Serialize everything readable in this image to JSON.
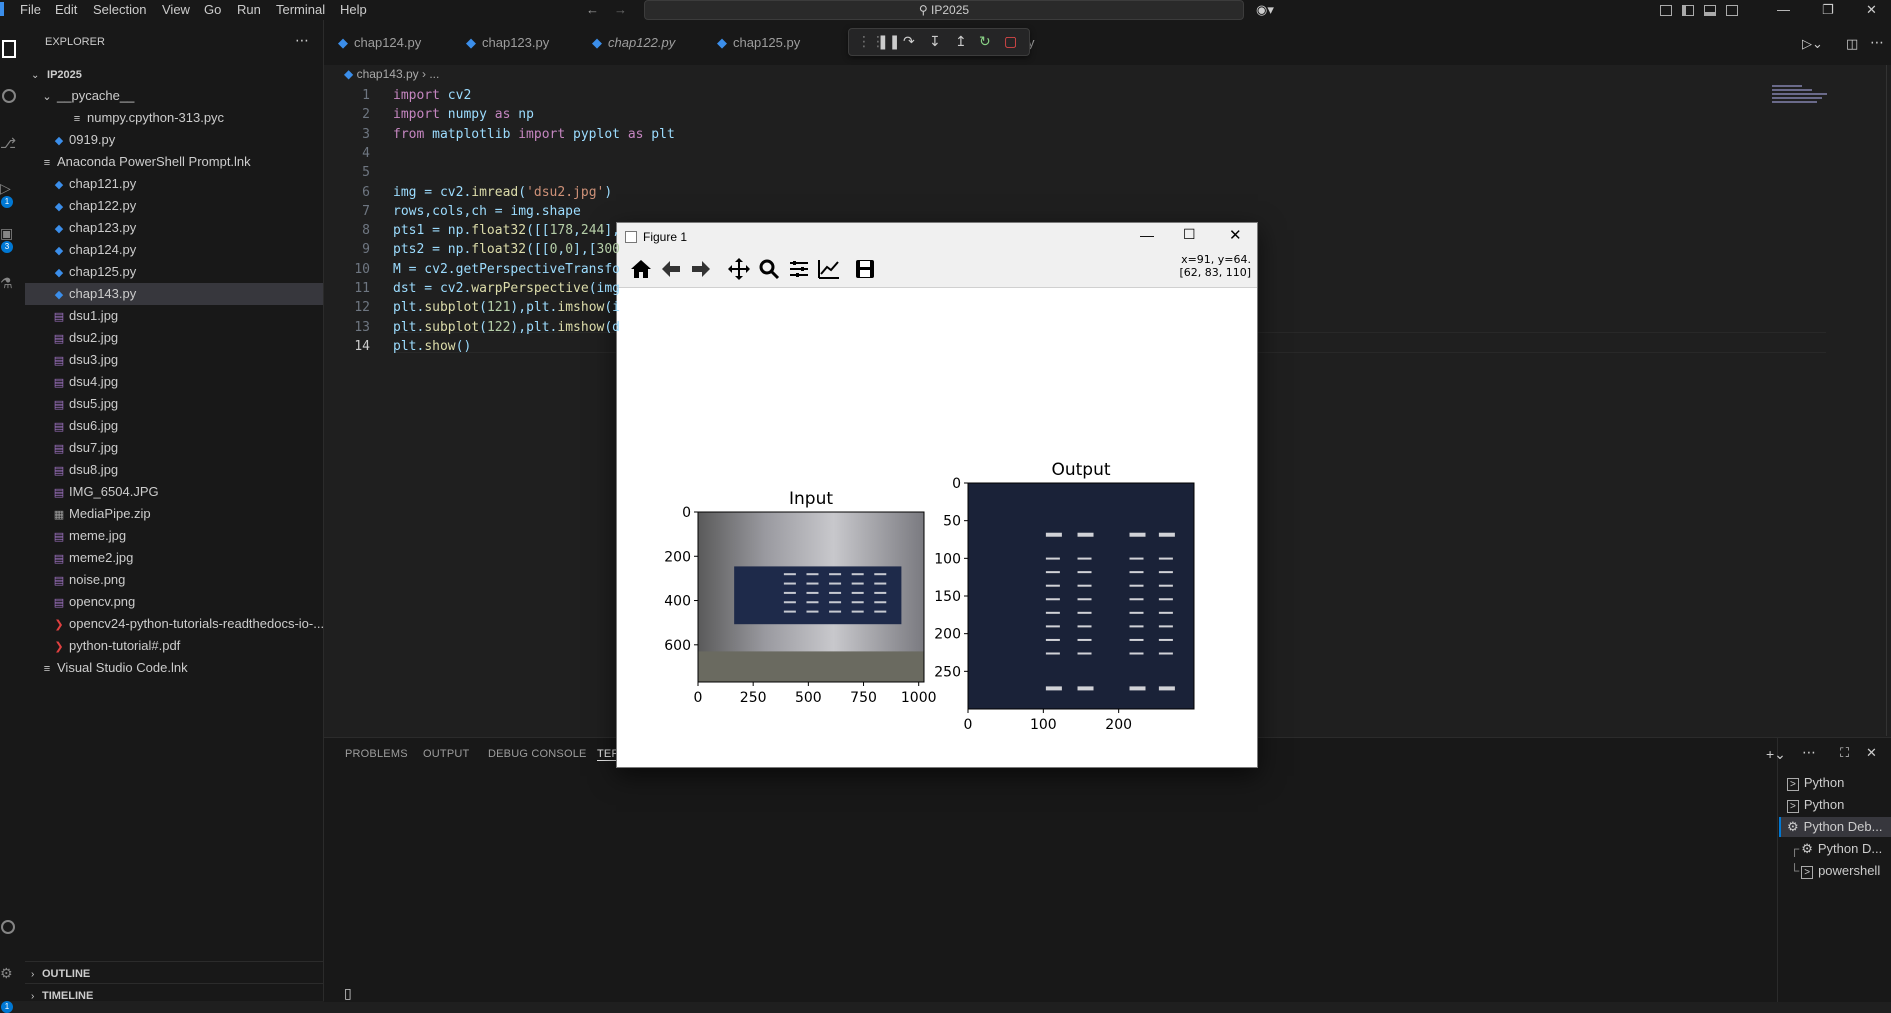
{
  "menu": {
    "file": "File",
    "edit": "Edit",
    "selection": "Selection",
    "view": "View",
    "go": "Go",
    "run": "Run",
    "terminal": "Terminal",
    "help": "Help"
  },
  "search": {
    "text": "IP2025"
  },
  "explorer": {
    "title": "EXPLORER",
    "root": "IP2025",
    "items": [
      {
        "label": "__pycache__",
        "type": "folder"
      },
      {
        "label": "numpy.cpython-313.pyc",
        "type": "file"
      },
      {
        "label": "0919.py",
        "type": "py"
      },
      {
        "label": "Anaconda PowerShell Prompt.lnk",
        "type": "file"
      },
      {
        "label": "chap121.py",
        "type": "py"
      },
      {
        "label": "chap122.py",
        "type": "py"
      },
      {
        "label": "chap123.py",
        "type": "py"
      },
      {
        "label": "chap124.py",
        "type": "py"
      },
      {
        "label": "chap125.py",
        "type": "py"
      },
      {
        "label": "chap143.py",
        "type": "py"
      },
      {
        "label": "dsu1.jpg",
        "type": "img"
      },
      {
        "label": "dsu2.jpg",
        "type": "img"
      },
      {
        "label": "dsu3.jpg",
        "type": "img"
      },
      {
        "label": "dsu4.jpg",
        "type": "img"
      },
      {
        "label": "dsu5.jpg",
        "type": "img"
      },
      {
        "label": "dsu6.jpg",
        "type": "img"
      },
      {
        "label": "dsu7.jpg",
        "type": "img"
      },
      {
        "label": "dsu8.jpg",
        "type": "img"
      },
      {
        "label": "IMG_6504.JPG",
        "type": "img"
      },
      {
        "label": "MediaPipe.zip",
        "type": "zip"
      },
      {
        "label": "meme.jpg",
        "type": "img"
      },
      {
        "label": "meme2.jpg",
        "type": "img"
      },
      {
        "label": "noise.png",
        "type": "img"
      },
      {
        "label": "opencv.png",
        "type": "img"
      },
      {
        "label": "opencv24-python-tutorials-readthedocs-io-...",
        "type": "pdf"
      },
      {
        "label": "python-tutorial#.pdf",
        "type": "pdf"
      },
      {
        "label": "Visual Studio Code.lnk",
        "type": "file"
      }
    ],
    "outline": "OUTLINE",
    "timeline": "TIMELINE"
  },
  "tabs": [
    "chap124.py",
    "chap123.py",
    "chap122.py",
    "chap125.py",
    "y"
  ],
  "breadcrumb": {
    "file": "chap143.py",
    "rest": "..."
  },
  "code": {
    "line_numbers": [
      "1",
      "2",
      "3",
      "4",
      "5",
      "6",
      "7",
      "8",
      "9",
      "10",
      "11",
      "12",
      "13",
      "14"
    ],
    "l1": "import cv2",
    "l2": "import numpy as np",
    "l3": "from matplotlib import pyplot as plt",
    "l6": "img = cv2.imread('dsu2.jpg')",
    "l7": "rows,cols,ch = img.shape",
    "l8": "pts1 = np.float32([[178,244],",
    "l9": "pts2 = np.float32([[0,0],[300",
    "l10": "M = cv2.getPerspectiveTransfo",
    "l11": "dst = cv2.warpPerspective(img",
    "l12": "plt.subplot(121),plt.imshow(i",
    "l13": "plt.subplot(122),plt.imshow(d",
    "l14": "plt.show()"
  },
  "panel": {
    "problems": "PROBLEMS",
    "output": "OUTPUT",
    "debug_console": "DEBUG CONSOLE",
    "terminal": "TER"
  },
  "terminals": [
    "Python",
    "Python",
    "Python Deb...",
    "Python D...",
    "powershell"
  ],
  "figure": {
    "title": "Figure 1",
    "coords_line1": "x=91, y=64.",
    "coords_line2": "[62, 83, 110]"
  },
  "chart_data": [
    {
      "type": "image",
      "title": "Input",
      "x_ticks": [
        "0",
        "250",
        "500",
        "750",
        "1000"
      ],
      "y_ticks": [
        "0",
        "200",
        "400",
        "600"
      ],
      "xlim": [
        0,
        1024
      ],
      "ylim": [
        768,
        0
      ]
    },
    {
      "type": "image",
      "title": "Output",
      "x_ticks": [
        "0",
        "100",
        "200"
      ],
      "y_ticks": [
        "0",
        "50",
        "100",
        "150",
        "200",
        "250"
      ],
      "xlim": [
        0,
        300
      ],
      "ylim": [
        300,
        0
      ]
    }
  ]
}
